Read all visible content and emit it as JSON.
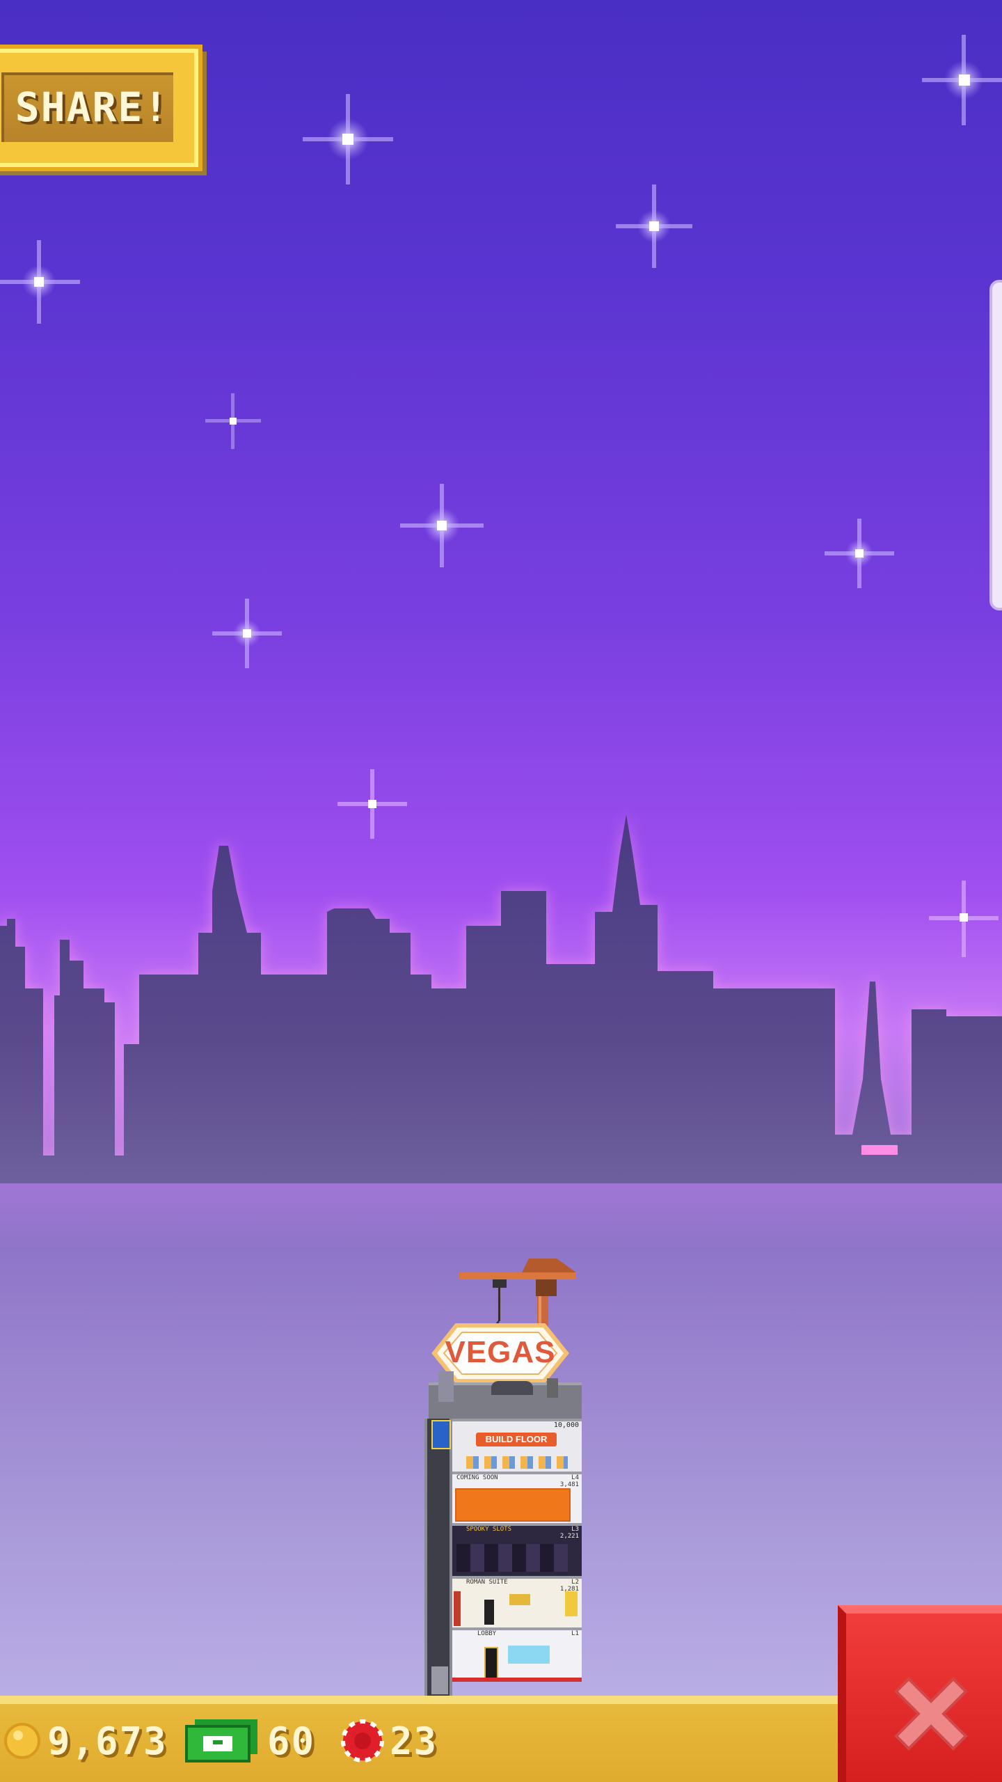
{
  "share_button": {
    "label": "SHARE!"
  },
  "tower": {
    "sign": "VEGAS",
    "top_floor_cost": "10,000",
    "build_button": "BUILD FLOOR",
    "floors": [
      {
        "name": "COMING SOON",
        "level": "L4",
        "value": "3,481"
      },
      {
        "name": "SPOOKY SLOTS",
        "level": "L3",
        "value": "2,221"
      },
      {
        "name": "ROMAN SUITE",
        "level": "L2",
        "value": "1,281"
      },
      {
        "name": "LOBBY",
        "level": "L1",
        "value": ""
      }
    ]
  },
  "hud": {
    "coins": "9,673",
    "bux": "60",
    "chips": "23",
    "icons": {
      "coins": "gold-coin-icon",
      "bux": "green-cash-icon",
      "chips": "red-chip-icon",
      "close": "close-x-icon"
    }
  },
  "colors": {
    "sky_top": "#4a2fc4",
    "sky_glow": "#c87af5",
    "skyline": "#4f3f80",
    "button_gold": "#f5c53a",
    "close_red": "#e32a2a",
    "bar_gold": "#e7b93c"
  }
}
